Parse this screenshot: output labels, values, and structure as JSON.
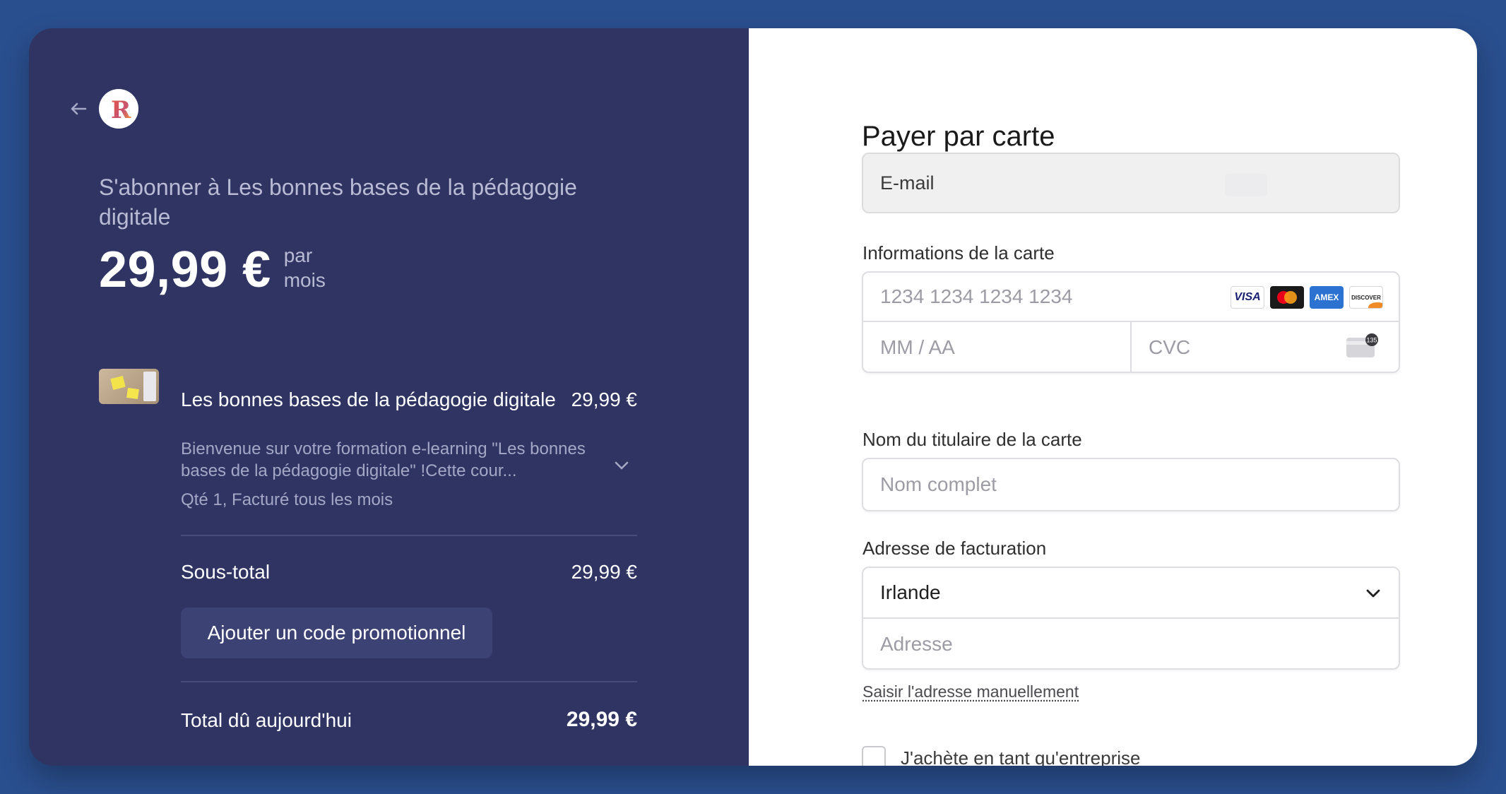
{
  "summary": {
    "subscribe_title": "S'abonner à Les bonnes bases de la pédagogie digitale",
    "price": "29,99 €",
    "period": "par mois",
    "product": {
      "name": "Les bonnes bases de la pédagogie digitale",
      "price": "29,99 €",
      "description": "Bienvenue sur votre formation e-learning \"Les bonnes bases de la pédagogie digitale\" !Cette cour...",
      "quantity": "Qté 1, Facturé tous les mois"
    },
    "subtotal_label": "Sous-total",
    "subtotal_value": "29,99 €",
    "promo_label": "Ajouter un code promotionnel",
    "total_label": "Total dû aujourd'hui",
    "total_value": "29,99 €",
    "logo_letter": "R"
  },
  "payment": {
    "title": "Payer par carte",
    "email_label": "E-mail",
    "card_section_label": "Informations de la carte",
    "card_number_placeholder": "1234 1234 1234 1234",
    "expiry_placeholder": "MM / AA",
    "cvc_placeholder": "CVC",
    "cvc_badge": "135",
    "card_brands": [
      "VISA",
      "mastercard",
      "AMEX",
      "DISCOVER"
    ],
    "name_section_label": "Nom du titulaire de la carte",
    "name_placeholder": "Nom complet",
    "address_section_label": "Adresse de facturation",
    "country": "Irlande",
    "address_placeholder": "Adresse",
    "manual_link": "Saisir l'adresse manuellement",
    "business_label": "J'achète en tant qu'entreprise"
  },
  "colors": {
    "page_background": "#2a4f8e",
    "summary_background": "#2f3463",
    "form_background": "#ffffff"
  }
}
